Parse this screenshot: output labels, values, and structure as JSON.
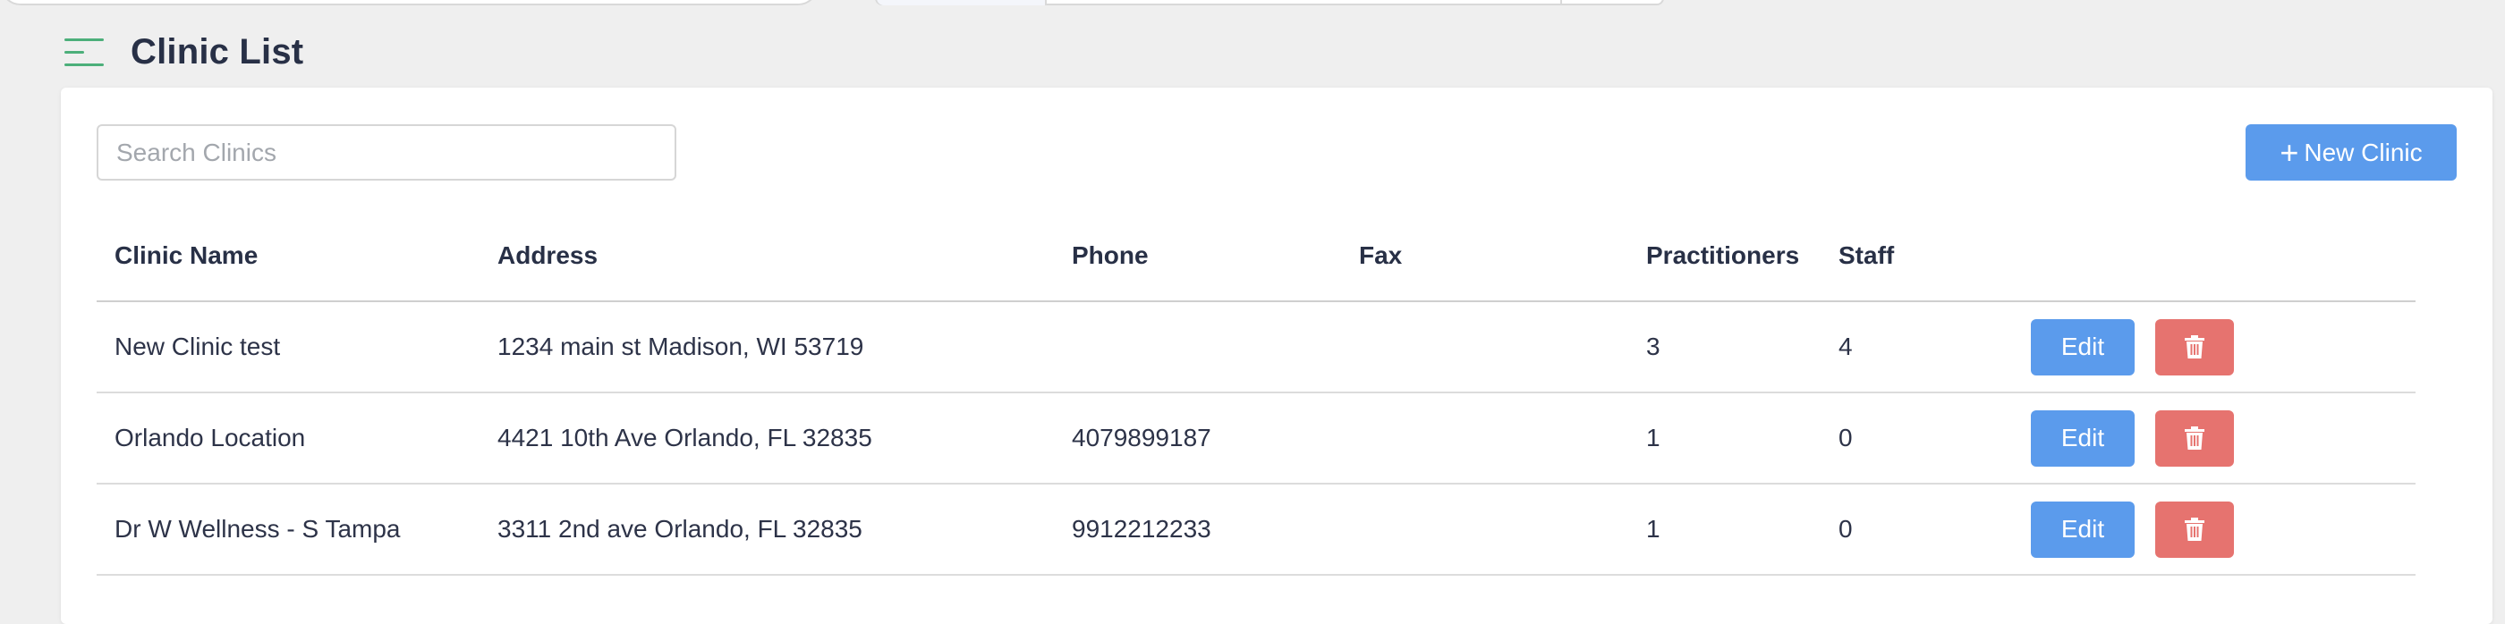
{
  "page": {
    "title": "Clinic List"
  },
  "toolbar": {
    "search_placeholder": "Search Clinics",
    "new_button_label": "New Clinic",
    "new_button_icon": "plus-icon"
  },
  "table": {
    "headers": {
      "name": "Clinic Name",
      "address": "Address",
      "phone": "Phone",
      "fax": "Fax",
      "practitioners": "Practitioners",
      "staff": "Staff"
    },
    "rows": [
      {
        "name": "New Clinic test",
        "address": "1234 main st Madison, WI 53719",
        "phone": "",
        "fax": "",
        "practitioners": "3",
        "staff": "4",
        "edit_label": "Edit",
        "delete_icon": "trash-icon"
      },
      {
        "name": "Orlando Location",
        "address": "4421 10th Ave Orlando, FL 32835",
        "phone": "4079899187",
        "fax": "",
        "practitioners": "1",
        "staff": "0",
        "edit_label": "Edit",
        "delete_icon": "trash-icon"
      },
      {
        "name": "Dr W Wellness - S Tampa",
        "address": "3311 2nd ave Orlando, FL 32835",
        "phone": "9912212233",
        "fax": "",
        "practitioners": "1",
        "staff": "0",
        "edit_label": "Edit",
        "delete_icon": "trash-icon"
      }
    ]
  },
  "colors": {
    "primary": "#5b9bec",
    "danger": "#e6736f",
    "menu_icon": "#4caf7a",
    "background": "#efefef"
  }
}
